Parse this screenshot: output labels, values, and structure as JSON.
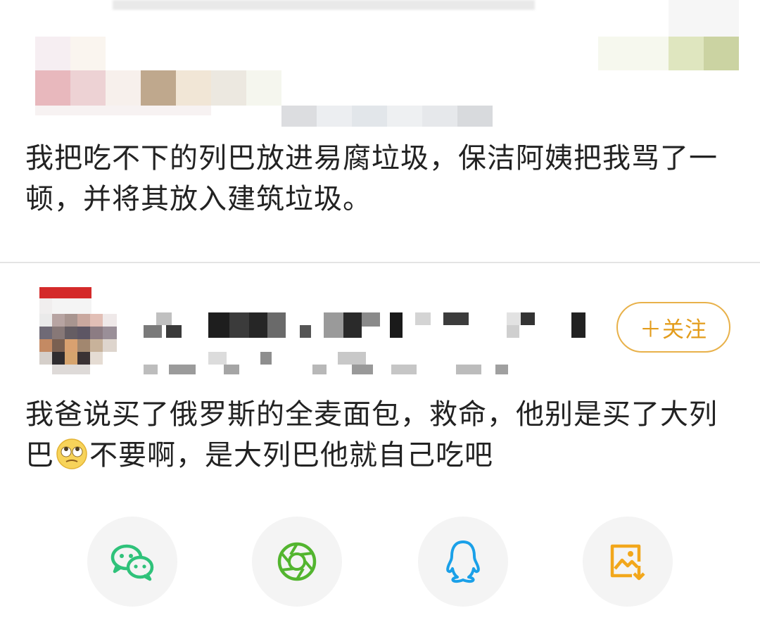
{
  "post1": {
    "text": "我把吃不下的列巴放进易腐垃圾，保洁阿姨把我骂了一顿，并将其放入建筑垃圾。"
  },
  "post2": {
    "follow_label": "＋关注",
    "text_before_emoji": "我爸说买了俄罗斯的全麦面包，救命，他别是买了大列巴",
    "emoji": "rolling-eyes-emoji",
    "text_after_emoji": "不要啊，是大列巴他就自己吃吧"
  },
  "share_bar": {
    "items": [
      {
        "icon": "wechat-icon",
        "color": "#2fc27a"
      },
      {
        "icon": "moments-icon",
        "color": "#53b52f"
      },
      {
        "icon": "qq-icon",
        "color": "#1aa0e8"
      },
      {
        "icon": "save-image-icon",
        "color": "#f2a71b"
      }
    ]
  },
  "colors": {
    "follow_border": "#e8b14a",
    "follow_text": "#e39c1b",
    "divider": "#e4e4e4"
  }
}
